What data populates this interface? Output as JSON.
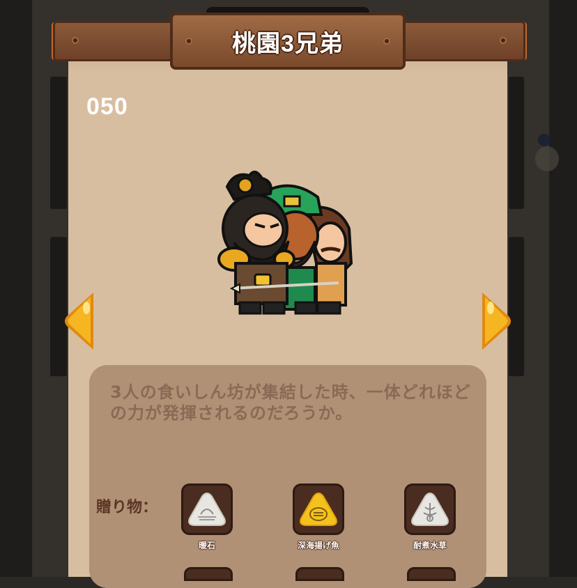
{
  "header": {
    "title": "桃園3兄弟"
  },
  "character": {
    "number": "050",
    "portrait_icon": "three-brothers-portrait",
    "description": "3人の食いしん坊が集結した時、一体どれほどの力が発揮されるのだろうか。"
  },
  "navigation": {
    "prev_icon": "arrow-left-icon",
    "next_icon": "arrow-right-icon"
  },
  "gifts": {
    "label": "贈り物：",
    "items": [
      {
        "name": "暖石",
        "icon": "warm-stone-icon",
        "rarity": "common"
      },
      {
        "name": "深海揚げ魚",
        "icon": "fried-fish-icon",
        "rarity": "rare"
      },
      {
        "name": "耐煮水草",
        "icon": "water-weed-icon",
        "rarity": "common"
      }
    ]
  },
  "colors": {
    "panel": "#d8bea0",
    "wood": "#8b5a3a",
    "accent_orange": "#f0a020",
    "text_brown": "#8a6a55"
  }
}
